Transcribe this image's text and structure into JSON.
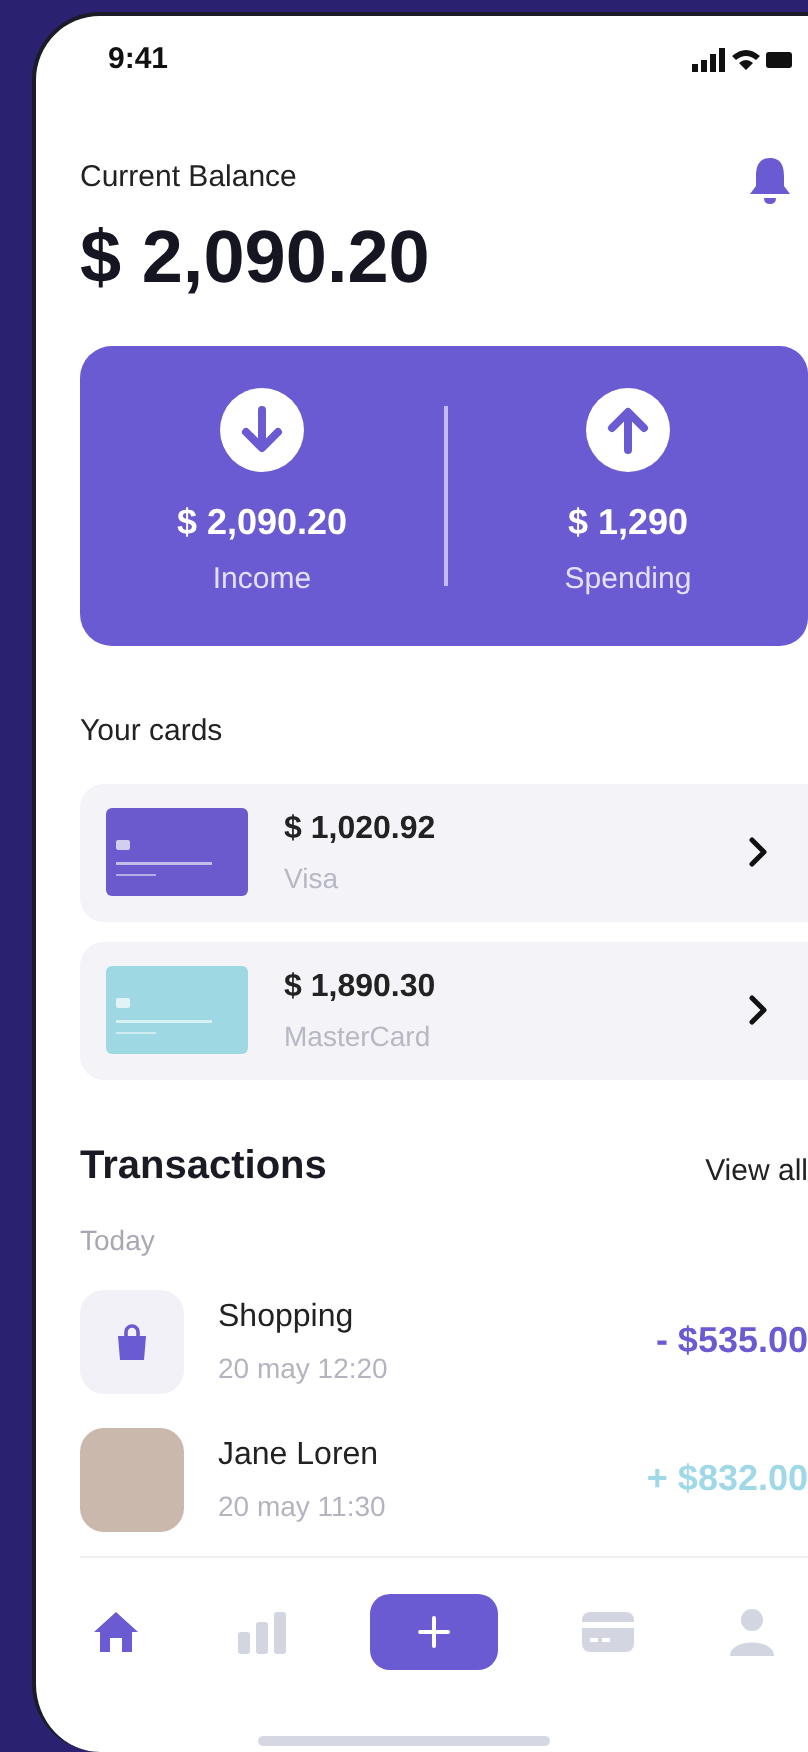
{
  "status_bar": {
    "time": "9:41"
  },
  "balance": {
    "label": "Current Balance",
    "amount": "$ 2,090.20"
  },
  "summary": [
    {
      "kind": "income",
      "amount": "$ 2,090.20",
      "label": "Income"
    },
    {
      "kind": "spending",
      "amount": "$ 1,290",
      "label": "Spending"
    }
  ],
  "cards_title": "Your cards",
  "cards": [
    {
      "amount": "$ 1,020.92",
      "name": "Visa",
      "color": "#6a5acd"
    },
    {
      "amount": "$ 1,890.30",
      "name": "MasterCard",
      "color": "#9ed8e2"
    }
  ],
  "transactions": {
    "title": "Transactions",
    "view_all": "View all",
    "group": "Today",
    "items": [
      {
        "kind": "icon",
        "color": "#6b5bd2",
        "name": "Shopping",
        "time": "20 may 12:20",
        "amount": "- $535.00"
      },
      {
        "kind": "photo",
        "color": "#9fd8e6",
        "name": "Jane Loren",
        "time": "20 may 11:30",
        "amount": "+ $832.00"
      }
    ]
  },
  "nav": [
    {
      "kind": "home",
      "selected": true
    },
    {
      "kind": "stats",
      "selected": false
    },
    {
      "kind": "add",
      "selected": false
    },
    {
      "kind": "card",
      "selected": false
    },
    {
      "kind": "profile",
      "selected": false
    }
  ]
}
